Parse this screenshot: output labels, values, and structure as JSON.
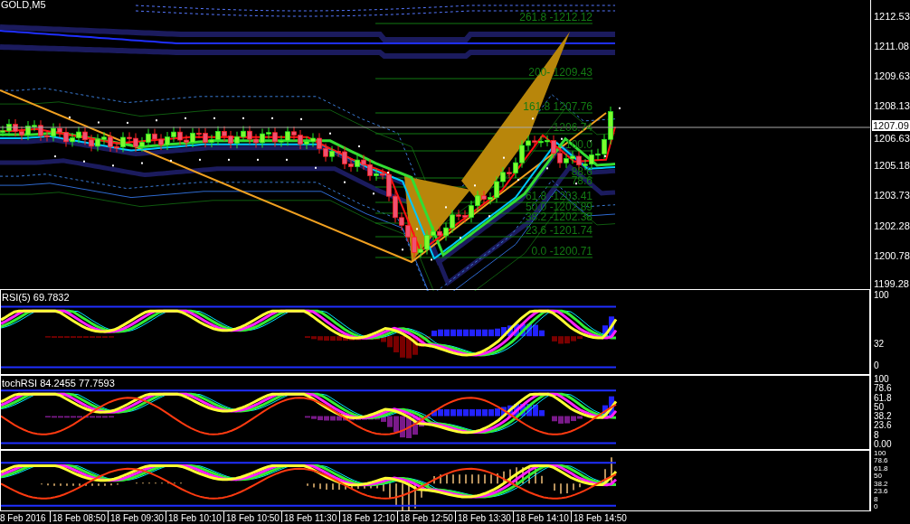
{
  "chart": {
    "symbol": "GOLD,M5",
    "fib_levels": [
      "261.8 -1212.12",
      "200- 1209.43",
      "161.8 1207.76",
      "-1206.74",
      "100.0",
      "88.6",
      "78.6",
      "61.8 -1203.41",
      "50.0 -1202.89",
      "38.2 -1202.38",
      "23.6 -1201.74",
      "0.0 -1200.71"
    ],
    "price_axis": [
      {
        "label": "1212.53",
        "kind": "tick"
      },
      {
        "label": "1211.08",
        "kind": "tick"
      },
      {
        "label": "1209.63",
        "kind": "tick"
      },
      {
        "label": "1208.13",
        "kind": "tick"
      },
      {
        "label": "1207.09",
        "kind": "current"
      },
      {
        "label": "1206.63",
        "kind": "tick"
      },
      {
        "label": "1205.18",
        "kind": "tick"
      },
      {
        "label": "1203.73",
        "kind": "tick"
      },
      {
        "label": "1202.28",
        "kind": "tick"
      },
      {
        "label": "1200.78",
        "kind": "tick"
      },
      {
        "label": "1199.28",
        "kind": "tick"
      }
    ]
  },
  "indicators": [
    {
      "label": "RSI(5) 69.7832",
      "axis": [
        "100",
        "32",
        "0"
      ]
    },
    {
      "label": "tochRSI 84.2455 77.7593",
      "axis": [
        "100",
        "78.6",
        "61.8",
        "50",
        "38.2",
        "23.6",
        "8",
        "0.00"
      ]
    },
    {
      "axis": [
        "100",
        "78.6",
        "61.8",
        "50",
        "38.2",
        "23.6",
        "8",
        "0"
      ]
    }
  ],
  "time_axis": [
    "8 Feb 2016",
    "18 Feb 08:50",
    "18 Feb 09:30",
    "18 Feb 10:10",
    "18 Feb 10:50",
    "18 Feb 11:30",
    "18 Feb 12:10",
    "18 Feb 12:50",
    "18 Feb 13:30",
    "18 Feb 14:10",
    "18 Feb 14:50"
  ]
}
